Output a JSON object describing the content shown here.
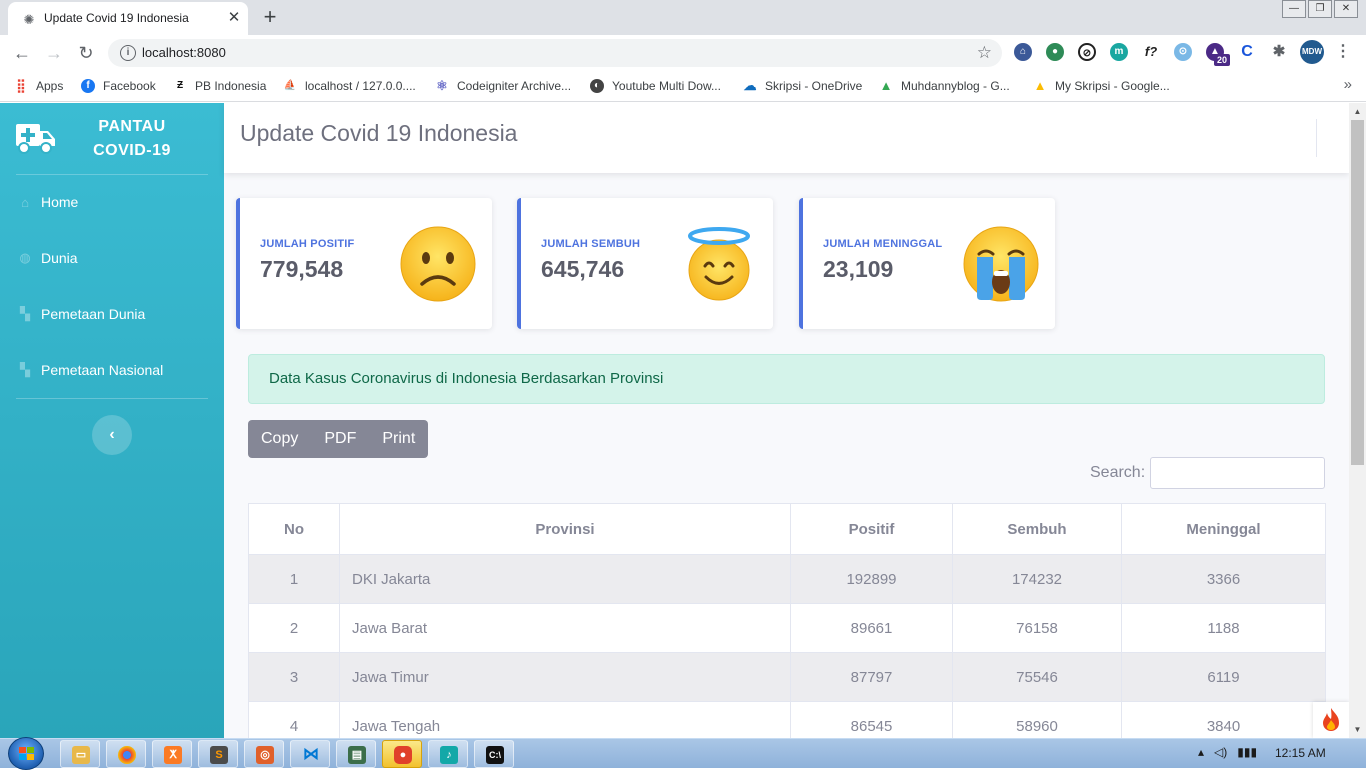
{
  "browser": {
    "tab_title": "Update Covid 19 Indonesia",
    "url": "localhost:8080",
    "bookmarks": [
      {
        "label": "Apps",
        "icon": "apps-grid-icon",
        "color": "#ea4335"
      },
      {
        "label": "Facebook",
        "icon": "facebook-icon",
        "color": "#1877f2"
      },
      {
        "label": "PB Indonesia",
        "icon": "pb-logo-icon",
        "color": "#111111"
      },
      {
        "label": "localhost / 127.0.0....",
        "icon": "phpmyadmin-icon",
        "color": "#f29111"
      },
      {
        "label": "Codeigniter Archive...",
        "icon": "react-atom-icon",
        "color": "#6b6fc9"
      },
      {
        "label": "Youtube Multi Dow...",
        "icon": "globe-icon",
        "color": "#444444"
      },
      {
        "label": "Skripsi - OneDrive",
        "icon": "onedrive-cloud-icon",
        "color": "#0f6cbd"
      },
      {
        "label": "Muhdannyblog - G...",
        "icon": "google-drive-icon",
        "color": "#34a853"
      },
      {
        "label": "My Skripsi - Google...",
        "icon": "google-drive-icon",
        "color": "#fbbc04"
      }
    ],
    "extension_badge": "20"
  },
  "sidebar": {
    "brand_line1": "PANTAU",
    "brand_line2": "COVID-19",
    "items": [
      {
        "label": "Home",
        "icon": "home-icon"
      },
      {
        "label": "Dunia",
        "icon": "globe-icon"
      },
      {
        "label": "Pemetaan Dunia",
        "icon": "map-icon"
      },
      {
        "label": "Pemetaan Nasional",
        "icon": "map-icon"
      }
    ],
    "toggle_icon": "chevron-left-icon"
  },
  "header": {
    "title": "Update Covid 19 Indonesia"
  },
  "cards": [
    {
      "label": "JUMLAH POSITIF",
      "value": "779,548",
      "emoji": "frowning-face-emoji"
    },
    {
      "label": "JUMLAH SEMBUH",
      "value": "645,746",
      "emoji": "smiling-face-with-halo-emoji"
    },
    {
      "label": "JUMLAH MENINGGAL",
      "value": "23,109",
      "emoji": "loudly-crying-face-emoji"
    }
  ],
  "alert": {
    "text": "Data Kasus Coronavirus di Indonesia Berdasarkan Provinsi"
  },
  "datatable": {
    "buttons": [
      "Copy",
      "PDF",
      "Print"
    ],
    "search_label": "Search:",
    "search_value": "",
    "columns": [
      "No",
      "Provinsi",
      "Positif",
      "Sembuh",
      "Meninggal"
    ],
    "rows": [
      [
        "1",
        "DKI Jakarta",
        "192899",
        "174232",
        "3366"
      ],
      [
        "2",
        "Jawa Barat",
        "89661",
        "76158",
        "1188"
      ],
      [
        "3",
        "Jawa Timur",
        "87797",
        "75546",
        "6119"
      ],
      [
        "4",
        "Jawa Tengah",
        "86545",
        "58960",
        "3840"
      ]
    ]
  },
  "taskbar": {
    "clock": "12:15 AM",
    "apps": [
      "windows-explorer-icon",
      "chrome-icon",
      "xampp-icon",
      "sublime-text-icon",
      "app-icon",
      "vscode-icon",
      "terminal-app-icon",
      "recorder-icon",
      "tiktok-icon",
      "cmd-icon"
    ]
  },
  "colors": {
    "sidebar": "#36b9cc",
    "primary": "#4e73df",
    "alert_bg": "#d4f3ea",
    "button_bg": "#858796"
  }
}
